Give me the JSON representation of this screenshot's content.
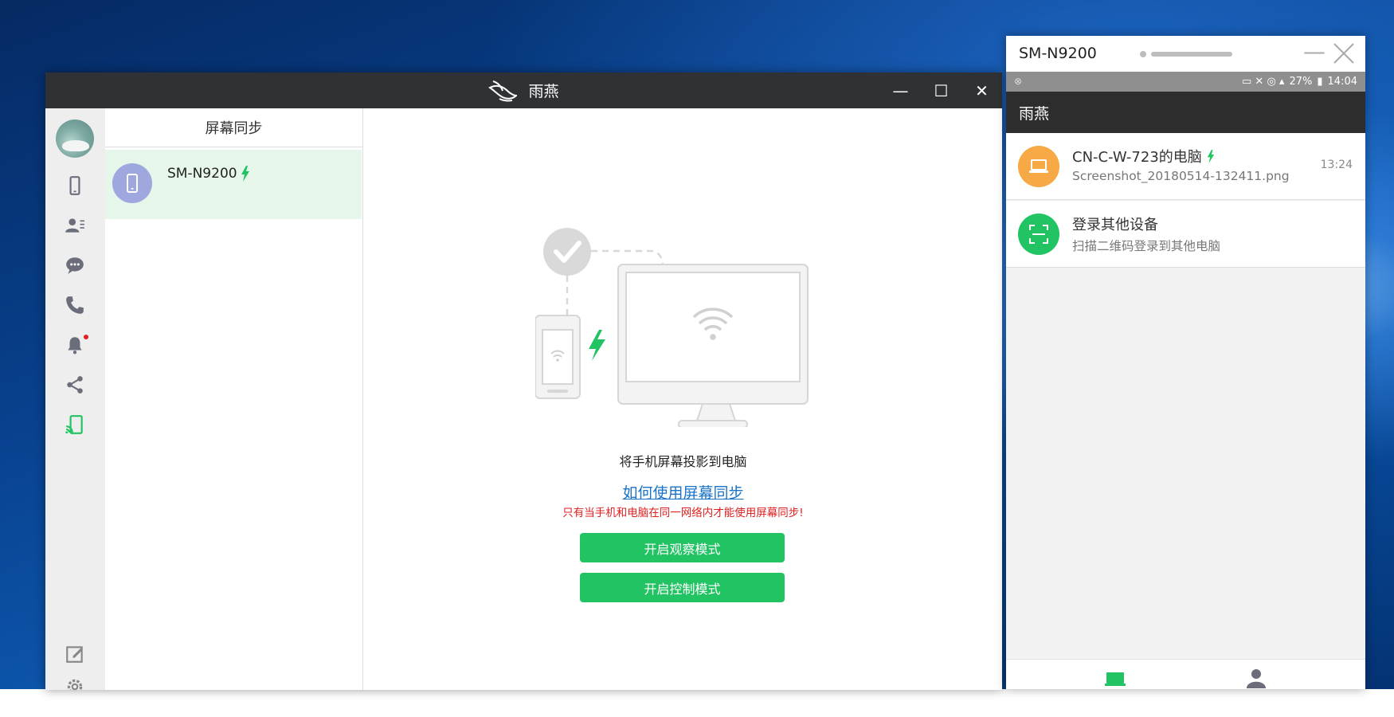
{
  "main_window": {
    "title": "雨燕",
    "controls": {
      "minimize": "—",
      "maximize": "☐",
      "close": "✕"
    },
    "sidebar": {
      "items": [
        {
          "name": "phone"
        },
        {
          "name": "contacts"
        },
        {
          "name": "messages"
        },
        {
          "name": "calls"
        },
        {
          "name": "notifications",
          "badge": true
        },
        {
          "name": "share"
        },
        {
          "name": "screen-cast",
          "active": true
        },
        {
          "name": "edit"
        },
        {
          "name": "settings"
        }
      ]
    },
    "device_list": {
      "header": "屏幕同步",
      "devices": [
        {
          "name": "SM-N9200"
        }
      ]
    },
    "content": {
      "caption": "将手机屏幕投影到电脑",
      "howto_link": "如何使用屏幕同步",
      "warning": "只有当手机和电脑在同一网络内才能使用屏幕同步!",
      "buttons": {
        "observe": "开启观察模式",
        "control": "开启控制模式"
      }
    }
  },
  "phone_window": {
    "title": "SM-N9200",
    "statusbar": {
      "battery": "27%",
      "time": "14:04"
    },
    "appbar_title": "雨燕",
    "rows": [
      {
        "title": "CN-C-W-723的电脑",
        "subtitle": "Screenshot_20180514-132411.png",
        "time": "13:24"
      },
      {
        "title": "登录其他设备",
        "subtitle": "扫描二维码登录到其他电脑"
      }
    ]
  },
  "colors": {
    "accent_green": "#22c363",
    "link_blue": "#1a73c9",
    "warning_red": "#e02020",
    "titlebar": "#2f3134"
  }
}
